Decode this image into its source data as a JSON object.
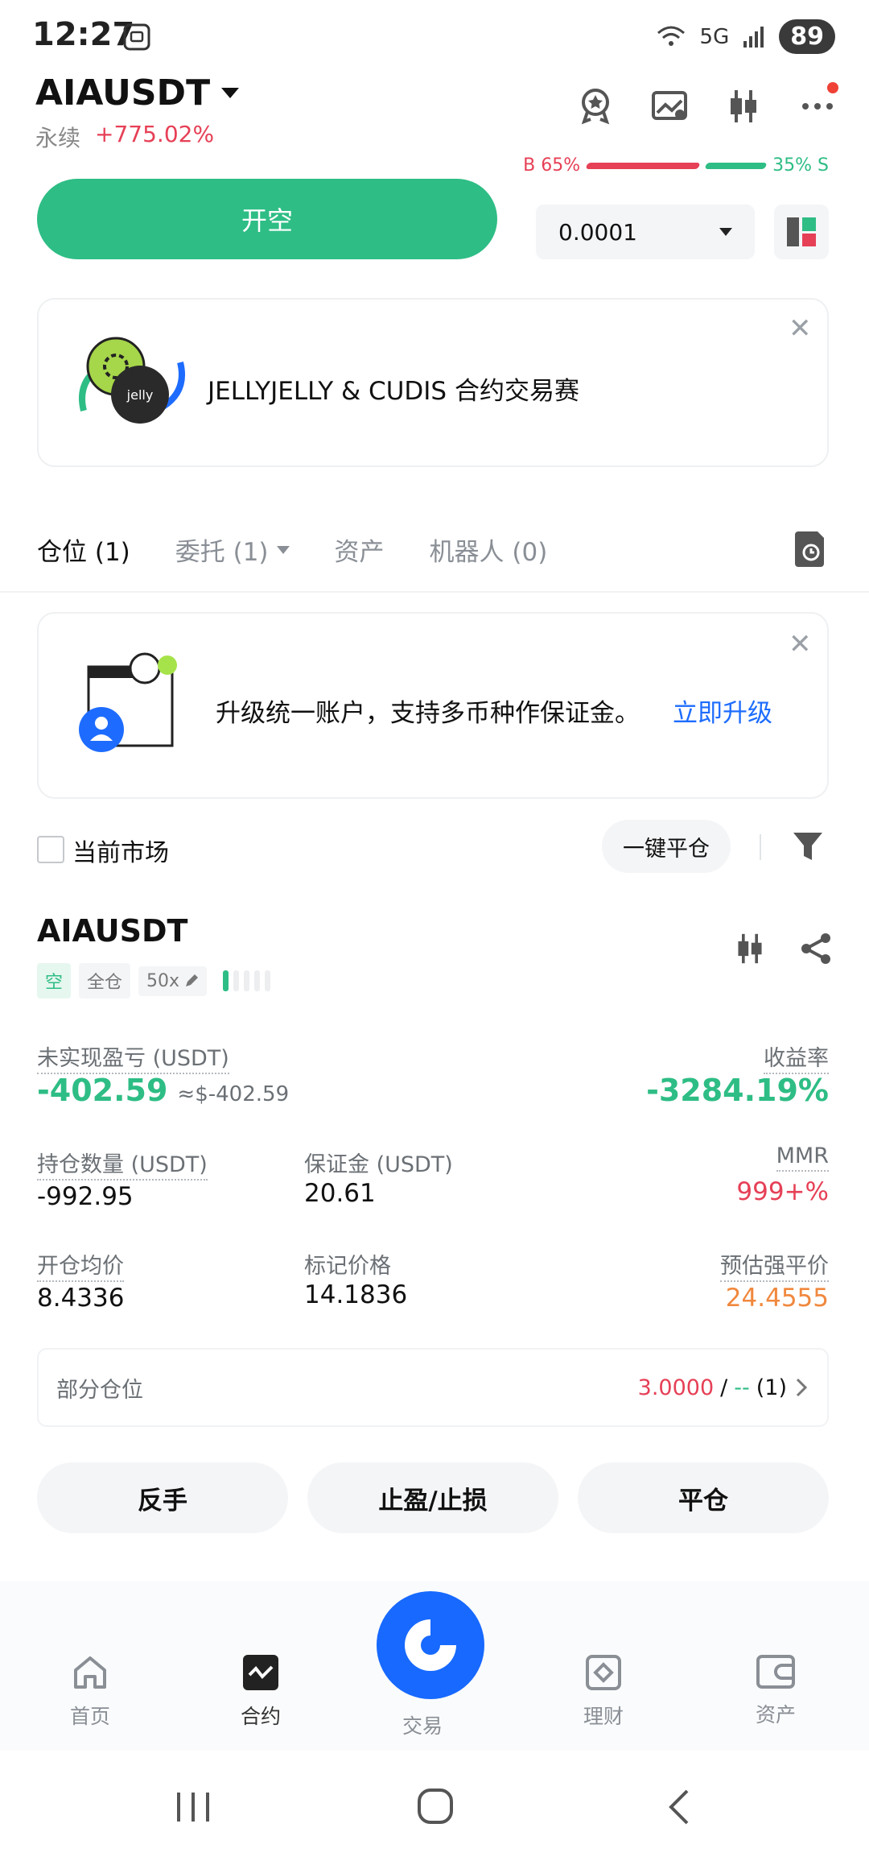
{
  "status": {
    "time": "12:27",
    "battery": "89",
    "network": "5G"
  },
  "header": {
    "symbol": "AIAUSDT",
    "type": "永续",
    "change": "+775.02%"
  },
  "ratio": {
    "buy": "B 65%",
    "sell": "35% S"
  },
  "trade": {
    "open_short_label": "开空",
    "quantity_value": "0.0001"
  },
  "banner": {
    "text": "JELLYJELLY & CUDIS 合约交易赛",
    "logo_text": "jelly"
  },
  "tabs": [
    {
      "label": "仓位 (1)"
    },
    {
      "label": "委托 (1)"
    },
    {
      "label": "资产"
    },
    {
      "label": "机器人 (0)"
    }
  ],
  "upgrade": {
    "text": "升级统一账户，支持多币种作保证金。",
    "link": "立即升级"
  },
  "filter": {
    "current_market_label": "当前市场",
    "close_all_label": "一键平仓"
  },
  "position": {
    "symbol": "AIAUSDT",
    "side_tag": "空",
    "margin_mode_tag": "全仓",
    "leverage_tag": "50x",
    "unrealized_pnl_label": "未实现盈亏 (USDT)",
    "unrealized_pnl_value": "-402.59",
    "unrealized_pnl_usd": "≈$-402.59",
    "roe_label": "收益率",
    "roe_value": "-3284.19%",
    "size_label": "持仓数量 (USDT)",
    "size_value": "-992.95",
    "margin_label": "保证金 (USDT)",
    "margin_value": "20.61",
    "mmr_label": "MMR",
    "mmr_value": "999+%",
    "entry_label": "开仓均价",
    "entry_value": "8.4336",
    "mark_label": "标记价格",
    "mark_value": "14.1836",
    "liq_label": "预估强平价",
    "liq_value": "24.4555",
    "partial_label": "部分仓位",
    "partial_tp": "3.0000",
    "partial_sep": "/",
    "partial_sl": "--",
    "partial_count": "(1)"
  },
  "actions": {
    "reverse": "反手",
    "tpsl": "止盈/止损",
    "close": "平仓"
  },
  "nav": [
    {
      "label": "首页"
    },
    {
      "label": "合约"
    },
    {
      "label": "交易"
    },
    {
      "label": "理财"
    },
    {
      "label": "资产"
    }
  ]
}
